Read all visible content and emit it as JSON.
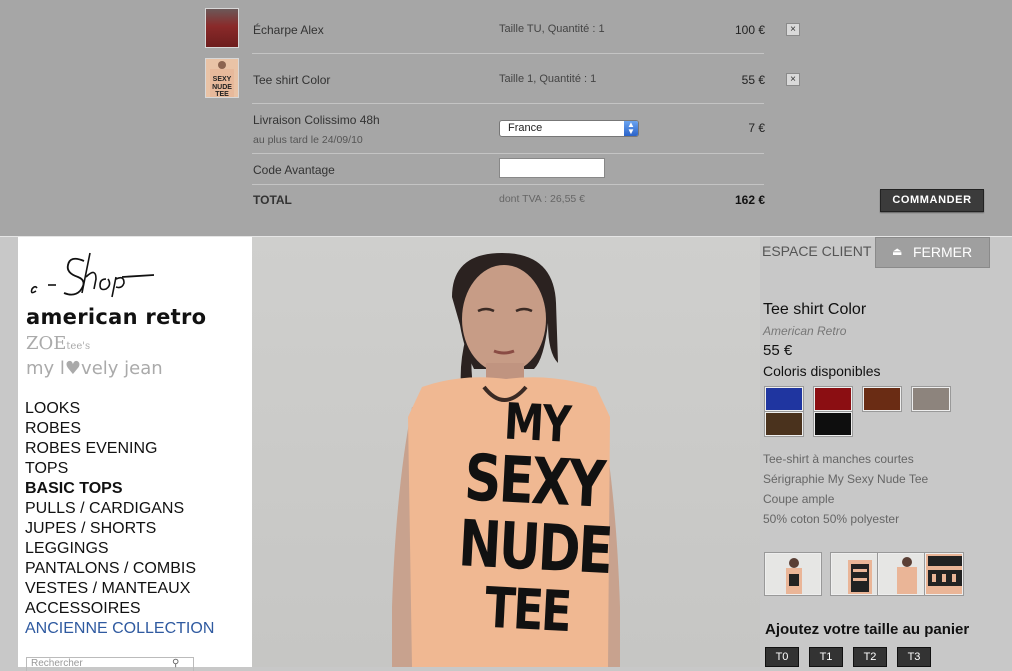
{
  "cart": {
    "items": [
      {
        "name": "Écharpe Alex",
        "details": "Taille TU,  Quantité : 1",
        "price": "100 €",
        "remove": "×"
      },
      {
        "name": "Tee shirt Color",
        "details": "Taille 1,  Quantité : 1",
        "price": "55 €",
        "remove": "×"
      }
    ],
    "shipping": {
      "label": "Livraison Colissimo 48h",
      "sublabel": "au plus tard le 24/09/10",
      "country": "France",
      "price": "7 €"
    },
    "code_label": "Code Avantage",
    "code_value": "",
    "total_label": "TOTAL",
    "tva": "dont TVA : 26,55 €",
    "total": "162 €",
    "order_button": "COMMANDER"
  },
  "sidebar": {
    "eshop": "e - Shop",
    "brand_main": "american retro",
    "brand_zoe": "ZOE",
    "brand_zoe_small": "tee's",
    "brand_mlj": "my l♥vely jean",
    "nav": [
      {
        "label": "LOOKS"
      },
      {
        "label": "ROBES"
      },
      {
        "label": "ROBES EVENING"
      },
      {
        "label": "TOPS"
      },
      {
        "label": "BASIC TOPS"
      },
      {
        "label": "PULLS / CARDIGANS"
      },
      {
        "label": "JUPES / SHORTS"
      },
      {
        "label": "LEGGINGS"
      },
      {
        "label": "PANTALONS / COMBIS"
      },
      {
        "label": "VESTES / MANTEAUX"
      },
      {
        "label": "ACCESSOIRES"
      },
      {
        "label": "ANCIENNE COLLECTION"
      }
    ],
    "search_placeholder": "Rechercher"
  },
  "photo": {
    "shirt_text": [
      "MY",
      "SEXY",
      "NUDE",
      "TEE"
    ]
  },
  "header": {
    "espace_client": "ESPACE CLIENT",
    "close_label": "FERMER",
    "close_icon": "eject-icon"
  },
  "product": {
    "title": "Tee shirt Color",
    "brand": "American Retro",
    "price": "55 €",
    "colors_label": "Coloris disponibles",
    "colors": [
      "#1f35a0",
      "#8b0e12",
      "#6a2c14",
      "#8d847d",
      "#4a321d",
      "#0e0e0e"
    ],
    "description": [
      "Tee-shirt à manches courtes",
      "Sérigraphie My Sexy Nude Tee",
      "Coupe ample",
      "50% coton 50% polyester"
    ],
    "thumbnail_count": 4,
    "size_label": "Ajoutez votre taille au panier",
    "sizes": [
      "T0",
      "T1",
      "T2",
      "T3"
    ]
  }
}
